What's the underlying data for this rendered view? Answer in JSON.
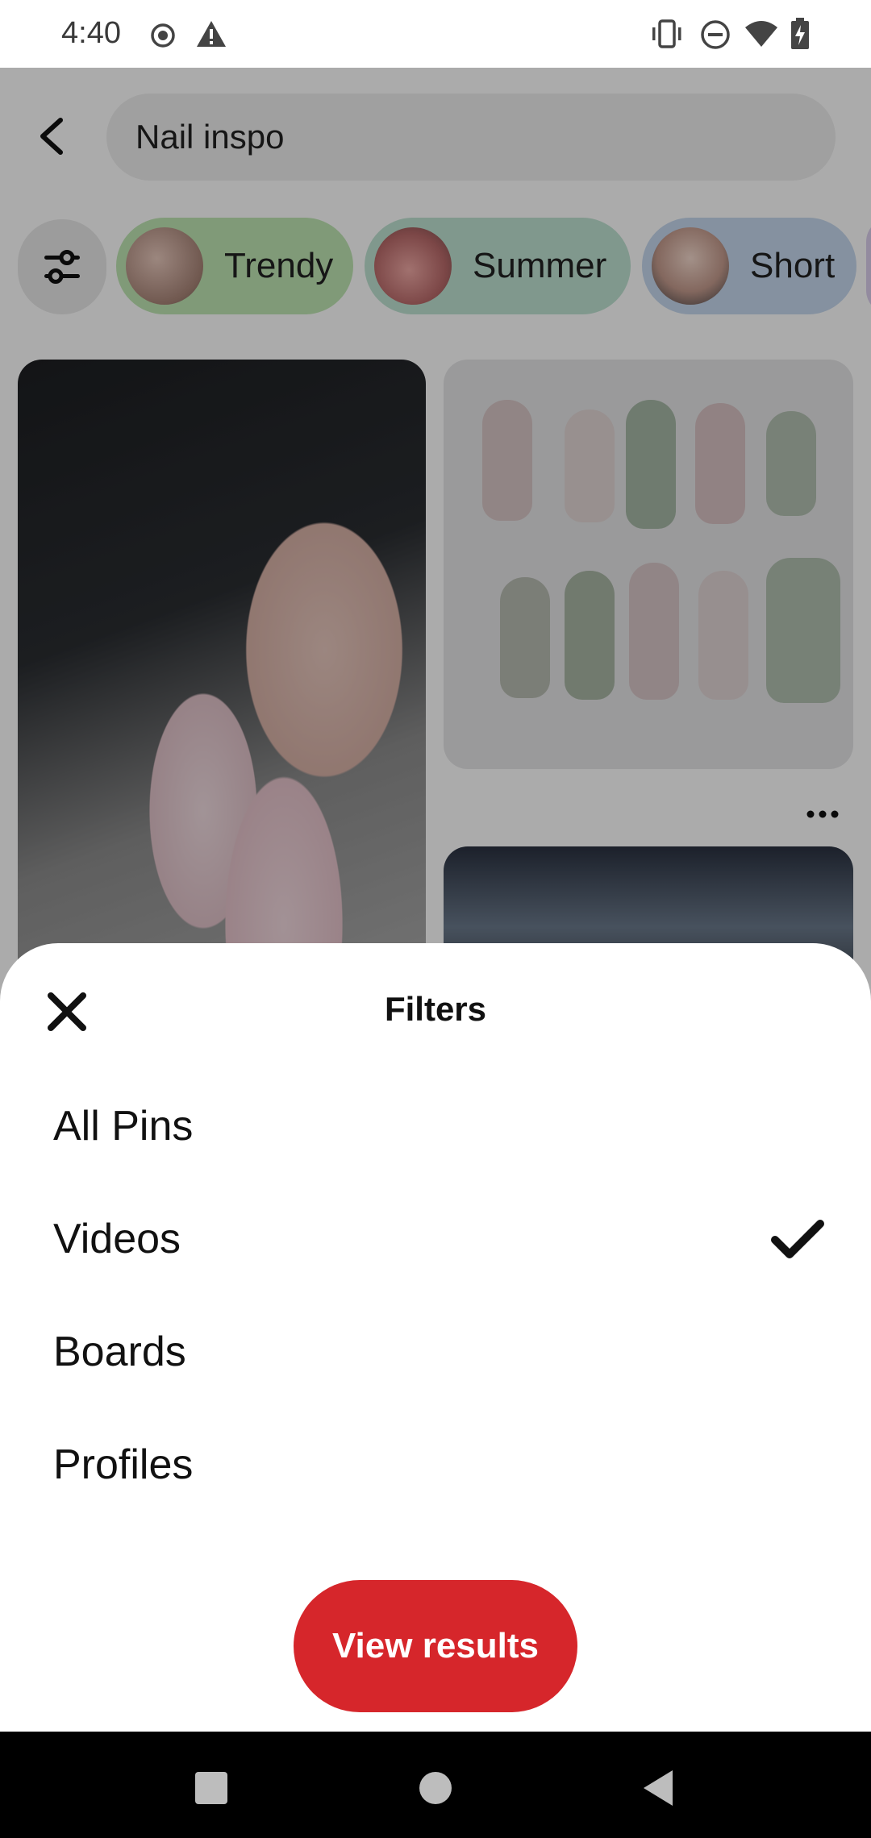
{
  "status_bar": {
    "time": "4:40",
    "icons": [
      "record-icon",
      "warning-icon",
      "vibrate-icon",
      "do-not-disturb-icon",
      "wifi-icon",
      "battery-charging-icon"
    ]
  },
  "search": {
    "query": "Nail inspo",
    "back_icon": "back-arrow-icon",
    "filter_icon": "sliders-icon"
  },
  "chips": [
    {
      "label": "Trendy",
      "color": "#bfe6b3"
    },
    {
      "label": "Summer",
      "color": "#bfe3d2"
    },
    {
      "label": "Short",
      "color": "#c6d9ef"
    }
  ],
  "pin_menu_icon": "more-dots-icon",
  "sheet": {
    "title": "Filters",
    "close_icon": "close-icon",
    "options": [
      {
        "label": "All Pins",
        "selected": false
      },
      {
        "label": "Videos",
        "selected": true
      },
      {
        "label": "Boards",
        "selected": false
      },
      {
        "label": "Profiles",
        "selected": false
      }
    ],
    "check_icon": "checkmark-icon",
    "cta_label": "View results",
    "cta_color": "#d6262b"
  },
  "nav_bar": {
    "icons": [
      "recents-square-icon",
      "home-circle-icon",
      "back-triangle-icon"
    ]
  }
}
